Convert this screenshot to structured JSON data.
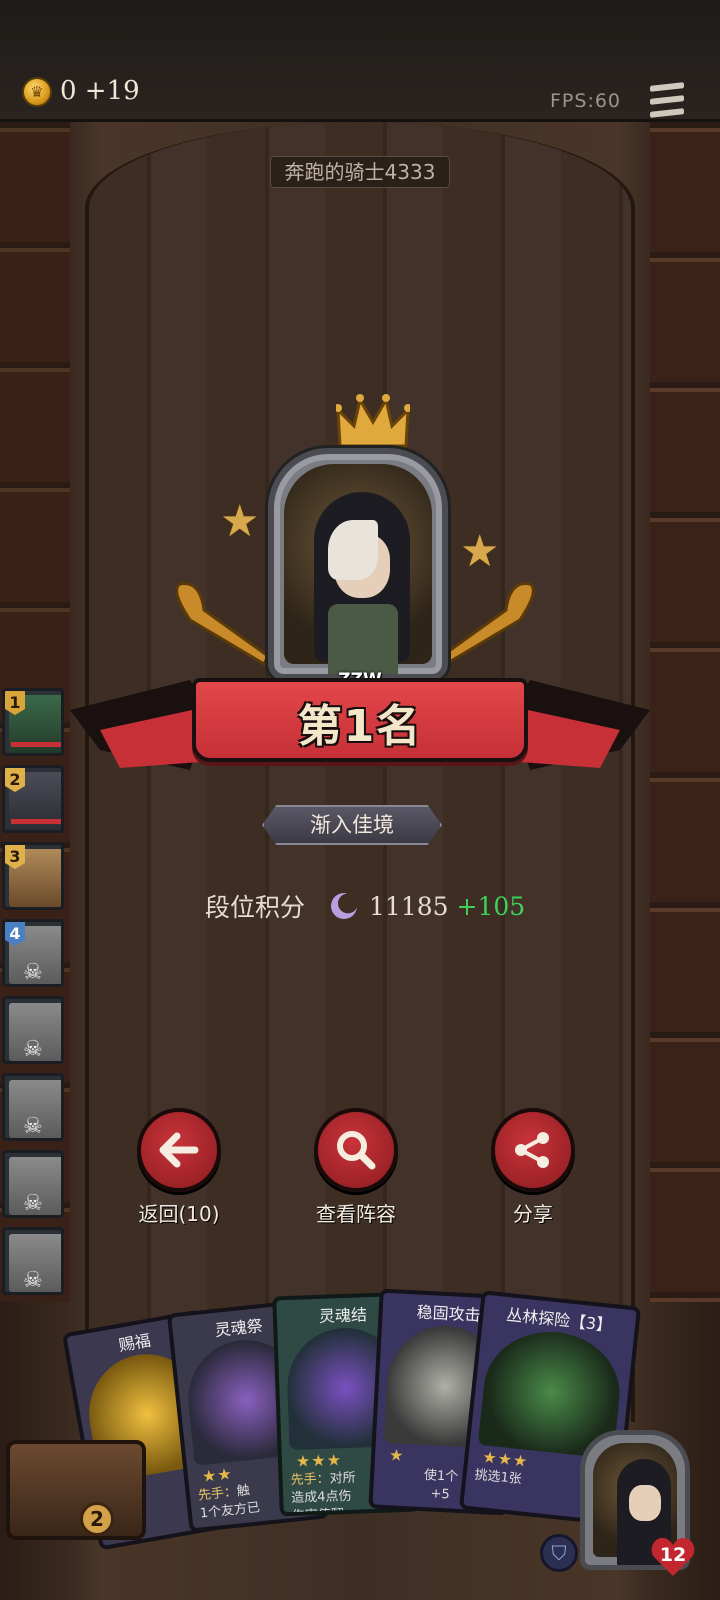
{
  "top_bar": {
    "gold_text": "0 +19",
    "fps_text": "FPS:60"
  },
  "player_name": "奔跑的骑士4333",
  "result": {
    "player_tag": "ZZW",
    "placement_text": "第1名",
    "rank_tier": "渐入佳境",
    "score_label": "段位积分",
    "score_value": "11185",
    "score_gain": "+105"
  },
  "ladder": [
    {
      "num": "1",
      "state": "alive"
    },
    {
      "num": "2",
      "state": "alive"
    },
    {
      "num": "3",
      "state": "alive"
    },
    {
      "num": "4",
      "state": "dead"
    },
    {
      "num": "",
      "state": "dead"
    },
    {
      "num": "",
      "state": "dead"
    },
    {
      "num": "",
      "state": "dead"
    },
    {
      "num": "",
      "state": "dead"
    }
  ],
  "actions": {
    "back_label": "返回(10)",
    "lineup_label": "查看阵容",
    "share_label": "分享"
  },
  "cards": [
    {
      "title": "赐福",
      "desc_line1": "",
      "desc_line2": ""
    },
    {
      "title": "灵魂祭",
      "desc_highlight": "先手：",
      "desc_line1": "触",
      "desc_line2": "1个友方已"
    },
    {
      "title": "灵魂结",
      "desc_highlight": "先手：",
      "desc_line1": "对所",
      "desc_line2": "造成4点伤",
      "desc_line3": "伤害值翻"
    },
    {
      "title": "稳固攻击",
      "desc_line1": "使1个",
      "desc_line2": "+5"
    },
    {
      "title": "丛林探险【3】",
      "desc_line1": "挑选1张"
    }
  ],
  "bottom": {
    "chest_count": "2",
    "hero_health": "12"
  },
  "colors": {
    "banner_red": "#d63a3e",
    "score_gain_green": "#3fd15a",
    "action_red": "#b42a30",
    "gold": "#d9a43a"
  }
}
